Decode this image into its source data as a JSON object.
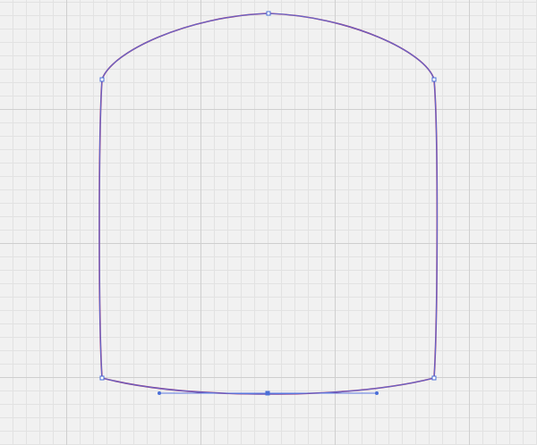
{
  "canvas": {
    "background_color": "#f1f1f1",
    "grid_minor_color": "#e2e2e2",
    "grid_major_color": "#cfcfcf",
    "grid_visible": true
  },
  "shape": {
    "stroke_color": "#8e2a7a",
    "path_highlight_color": "#5a78e0",
    "anchor_fill": "#ffffff",
    "anchor_stroke": "#4a6fd8",
    "selected_anchor_fill": "#4a6fd8"
  }
}
